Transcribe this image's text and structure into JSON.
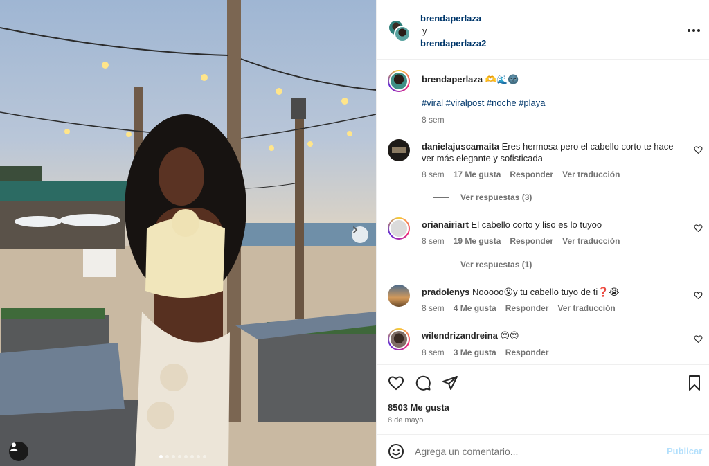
{
  "post": {
    "image_alt_subject": "woman on beach at dusk",
    "carousel": {
      "total": 8,
      "active_index": 0
    }
  },
  "header": {
    "author1": "brendaperlaza",
    "connector": "y",
    "author2": "brendaperlaza2",
    "more_icon": "more-horizontal-icon"
  },
  "caption": {
    "username": "brendaperlaza",
    "emojis": "🫶🌊🌚",
    "hashtags": "#viral #viralpost #noche #playa",
    "time": "8 sem"
  },
  "comments": [
    {
      "username": "danielajuscamaita",
      "text": "Eres hermosa pero el cabello corto te hace ver más elegante y sofisticada",
      "time": "8 sem",
      "likes": "17 Me gusta",
      "reply": "Responder",
      "translate": "Ver traducción",
      "replies": "Ver respuestas (3)"
    },
    {
      "username": "orianairiart",
      "text": "El cabello corto y liso es lo tuyoo",
      "time": "8 sem",
      "likes": "19 Me gusta",
      "reply": "Responder",
      "translate": "Ver traducción",
      "replies": "Ver respuestas (1)"
    },
    {
      "username": "pradolenys",
      "text": "Nooooo😮y tu cabello tuyo de ti❓😭",
      "time": "8 sem",
      "likes": "4 Me gusta",
      "reply": "Responder",
      "translate": "Ver traducción"
    },
    {
      "username": "wilendrizandreina",
      "text": "😍😍",
      "time": "8 sem",
      "likes": "3 Me gusta",
      "reply": "Responder"
    }
  ],
  "actions": {
    "likes": "8503 Me gusta",
    "date": "8 de mayo"
  },
  "compose": {
    "placeholder": "Agrega un comentario...",
    "publish": "Publicar"
  },
  "colors": {
    "link": "#00376b",
    "muted": "#737373",
    "publish_disabled": "#b2dffc"
  }
}
